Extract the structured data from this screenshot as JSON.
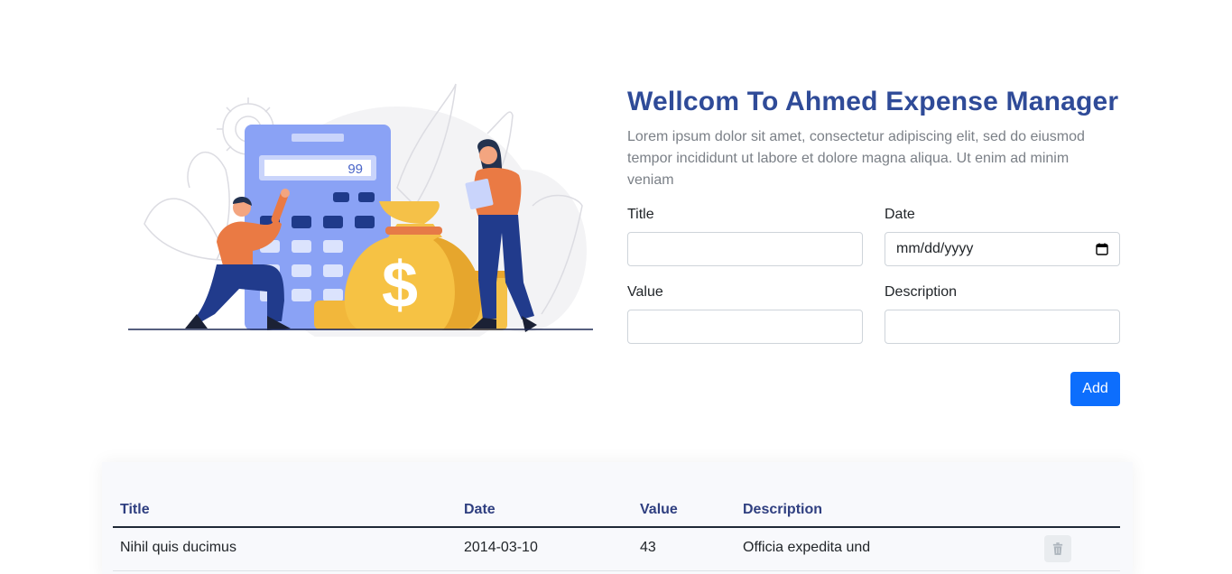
{
  "header": {
    "title": "Wellcom To Ahmed Expense Manager",
    "subtitle": "Lorem ipsum dolor sit amet, consectetur adipiscing elit, sed do eiusmod tempor incididunt ut labore et dolore magna aliqua. Ut enim ad minim veniam"
  },
  "illustration": {
    "calculator_display": "99",
    "currency_symbol": "$"
  },
  "form": {
    "title_label": "Title",
    "title_value": "",
    "date_label": "Date",
    "date_placeholder": "mm/dd/yyyy",
    "value_label": "Value",
    "value_value": "",
    "description_label": "Description",
    "description_value": "",
    "add_label": "Add"
  },
  "table": {
    "columns": [
      "Title",
      "Date",
      "Value",
      "Description"
    ],
    "rows": [
      {
        "title": "Nihil quis ducimus",
        "date": "2014-03-10",
        "value": "43",
        "description": "Officia expedita und"
      }
    ]
  },
  "colors": {
    "accent": "#0d6efd",
    "title": "#2f4b98",
    "table_header": "#2f3f80"
  }
}
